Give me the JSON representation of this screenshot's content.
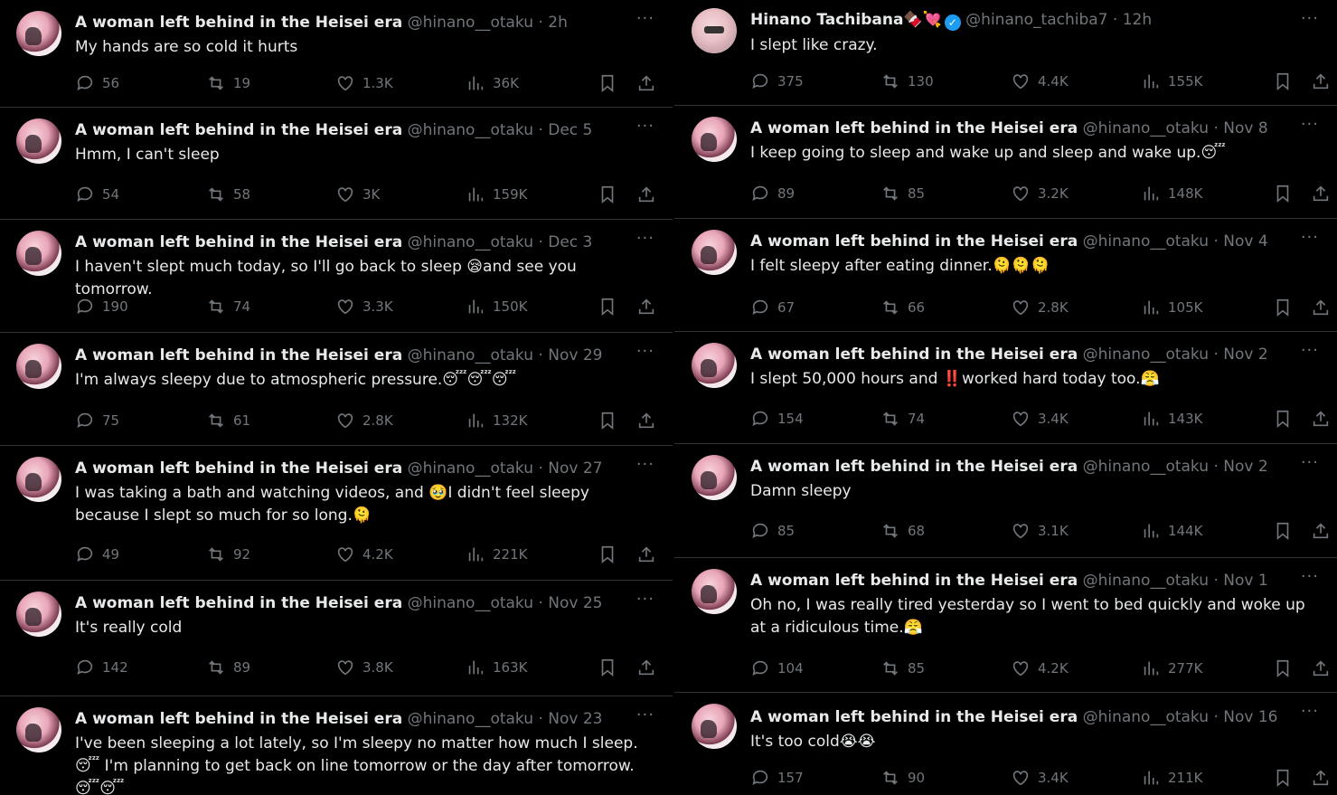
{
  "left_column": [
    {
      "name": "A woman left behind in the Heisei era",
      "handle": "@hinano__otaku",
      "time": "2h",
      "text": "My hands are so cold it hurts",
      "replies": "56",
      "reposts": "19",
      "likes": "1.3K",
      "views": "36K"
    },
    {
      "name": "A woman left behind in the Heisei era",
      "handle": "@hinano__otaku",
      "time": "Dec 5",
      "text": "Hmm, I can't sleep",
      "replies": "54",
      "reposts": "58",
      "likes": "3K",
      "views": "159K"
    },
    {
      "name": "A woman left behind in the Heisei era",
      "handle": "@hinano__otaku",
      "time": "Dec 3",
      "text": "I haven't slept much today, so I'll go back to sleep 😪and see you tomorrow.",
      "replies": "190",
      "reposts": "74",
      "likes": "3.3K",
      "views": "150K"
    },
    {
      "name": "A woman left behind in the Heisei era",
      "handle": "@hinano__otaku",
      "time": "Nov 29",
      "text": "I'm always sleepy due to atmospheric pressure.😴😴😴",
      "replies": "75",
      "reposts": "61",
      "likes": "2.8K",
      "views": "132K"
    },
    {
      "name": "A woman left behind in the Heisei era",
      "handle": "@hinano__otaku",
      "time": "Nov 27",
      "text": "I was taking a bath and watching videos, and 🥹I didn't feel sleepy because I slept so much for so long.🫠",
      "replies": "49",
      "reposts": "92",
      "likes": "4.2K",
      "views": "221K"
    },
    {
      "name": "A woman left behind in the Heisei era",
      "handle": "@hinano__otaku",
      "time": "Nov 25",
      "text": "It's really cold",
      "replies": "142",
      "reposts": "89",
      "likes": "3.8K",
      "views": "163K"
    },
    {
      "name": "A woman left behind in the Heisei era",
      "handle": "@hinano__otaku",
      "time": "Nov 23",
      "text": "I've been sleeping a lot lately, so I'm sleepy no matter how much I sleep. 😴 I'm planning to get back on line tomorrow or the day after tomorrow.😴😴",
      "replies": "",
      "reposts": "",
      "likes": "",
      "views": ""
    }
  ],
  "right_column": [
    {
      "name": "Hinano Tachibana🍫💘",
      "verified": "✓",
      "handle": "@hinano_tachiba7",
      "time": "12h",
      "text": "I slept like crazy.",
      "replies": "375",
      "reposts": "130",
      "likes": "4.4K",
      "views": "155K"
    },
    {
      "name": "A woman left behind in the Heisei era",
      "handle": "@hinano__otaku",
      "time": "Nov 8",
      "text": "I keep going to sleep and wake up and sleep and wake up.😴",
      "replies": "89",
      "reposts": "85",
      "likes": "3.2K",
      "views": "148K"
    },
    {
      "name": "A woman left behind in the Heisei era",
      "handle": "@hinano__otaku",
      "time": "Nov 4",
      "text": "I felt sleepy after eating dinner.🫠🫠🫠",
      "replies": "67",
      "reposts": "66",
      "likes": "2.8K",
      "views": "105K"
    },
    {
      "name": "A woman left behind in the Heisei era",
      "handle": "@hinano__otaku",
      "time": "Nov 2",
      "text": "I slept 50,000 hours and ‼️worked hard today too.😤",
      "replies": "154",
      "reposts": "74",
      "likes": "3.4K",
      "views": "143K"
    },
    {
      "name": "A woman left behind in the Heisei era",
      "handle": "@hinano__otaku",
      "time": "Nov 2",
      "text": "Damn sleepy",
      "replies": "85",
      "reposts": "68",
      "likes": "3.1K",
      "views": "144K"
    },
    {
      "name": "A woman left behind in the Heisei era",
      "handle": "@hinano__otaku",
      "time": "Nov 1",
      "text": "Oh no, I was really tired yesterday so I went to bed quickly and woke up at a ridiculous time.😤",
      "replies": "104",
      "reposts": "85",
      "likes": "4.2K",
      "views": "277K"
    },
    {
      "name": "A woman left behind in the Heisei era",
      "handle": "@hinano__otaku",
      "time": "Nov 16",
      "text": "It's too cold😭😭",
      "replies": "157",
      "reposts": "90",
      "likes": "3.4K",
      "views": "211K"
    }
  ],
  "ui": {
    "more_label": "···",
    "separator": "·"
  },
  "colors": {
    "background": "#000000",
    "text": "#e7e9ea",
    "muted": "#71767b",
    "border": "#2f3336",
    "verified": "#1d9bf0"
  }
}
